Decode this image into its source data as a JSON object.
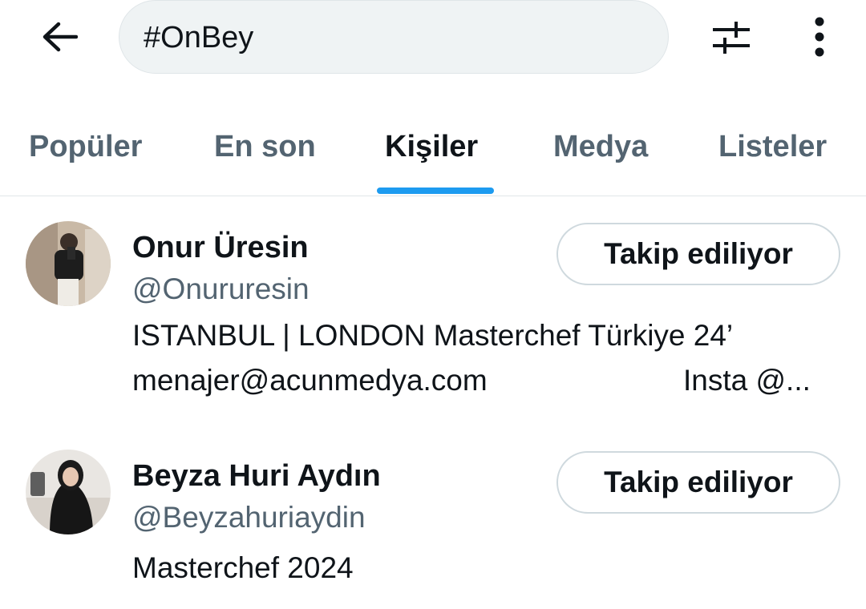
{
  "search": {
    "query": "#OnBey"
  },
  "icons": {
    "back": "arrow-left-icon",
    "filter": "sliders-icon",
    "more": "more-vertical-icon"
  },
  "tabs": [
    {
      "label": "Popüler",
      "active": false
    },
    {
      "label": "En son",
      "active": false
    },
    {
      "label": "Kişiler",
      "active": true
    },
    {
      "label": "Medya",
      "active": false
    },
    {
      "label": "Listeler",
      "active": false
    }
  ],
  "users": [
    {
      "name": "Onur Üresin",
      "handle": "@Onururesin",
      "bio_line1": "ISTANBUL | LONDON Masterchef Türkiye 24’",
      "bio_line2": "menajer@acunmedya.com",
      "bio_line2_extra": "Insta @...",
      "follow_label": "Takip ediliyor"
    },
    {
      "name": "Beyza Huri Aydın",
      "handle": "@Beyzahuriaydin",
      "bio_line1": "Masterchef 2024",
      "follow_label": "Takip ediliyor"
    }
  ],
  "colors": {
    "accent": "#1d9bf0",
    "text_primary": "#0f1419",
    "text_secondary": "#536471",
    "search_bg": "#eff3f4"
  }
}
